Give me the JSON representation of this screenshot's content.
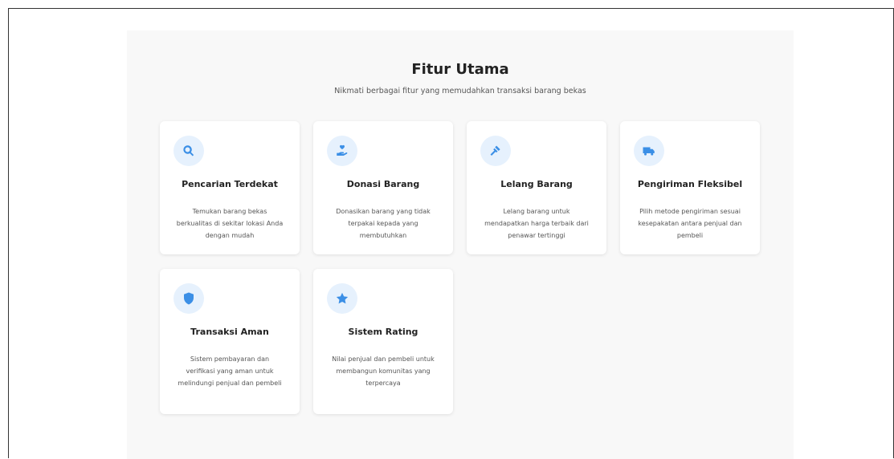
{
  "section": {
    "title": "Fitur Utama",
    "subtitle": "Nikmati berbagai fitur yang memudahkan transaksi barang bekas"
  },
  "features": [
    {
      "icon": "search-icon",
      "title": "Pencarian Terdekat",
      "description": "Temukan barang bekas berkualitas di sekitar lokasi Anda dengan mudah"
    },
    {
      "icon": "hand-holding-heart-icon",
      "title": "Donasi Barang",
      "description": "Donasikan barang yang tidak terpakai kepada yang membutuhkan"
    },
    {
      "icon": "gavel-icon",
      "title": "Lelang Barang",
      "description": "Lelang barang untuk mendapatkan harga terbaik dari penawar tertinggi"
    },
    {
      "icon": "truck-icon",
      "title": "Pengiriman Fleksibel",
      "description": "Pilih metode pengiriman sesuai kesepakatan antara penjual dan pembeli"
    },
    {
      "icon": "shield-icon",
      "title": "Transaksi Aman",
      "description": "Sistem pembayaran dan verifikasi yang aman untuk melindungi penjual dan pembeli"
    },
    {
      "icon": "star-icon",
      "title": "Sistem Rating",
      "description": "Nilai penjual dan pembeli untuk membangun komunitas yang terpercaya"
    }
  ],
  "colors": {
    "accent": "#3b8fe6",
    "icon_background": "#e6f1fd",
    "section_background": "#f8f8f8"
  }
}
